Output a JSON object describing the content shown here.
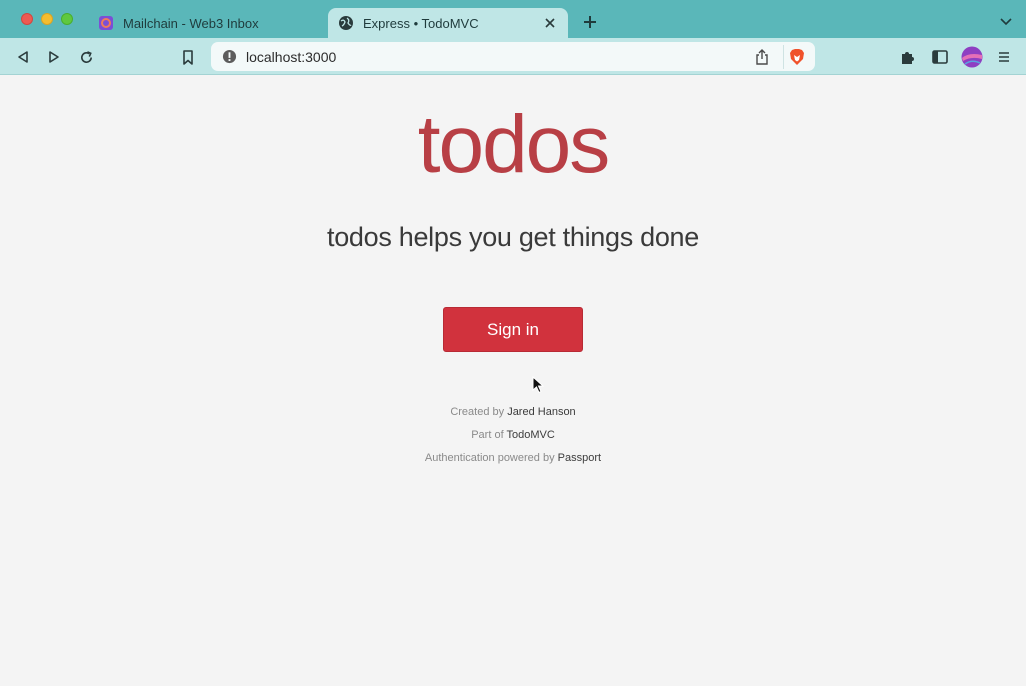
{
  "browser": {
    "tabs": [
      {
        "title": "Mailchain - Web3 Inbox",
        "favicon": "mailchain-icon"
      },
      {
        "title": "Express • TodoMVC",
        "favicon": "globe-icon"
      }
    ],
    "address": "localhost:3000",
    "colors": {
      "tabbar": "#5ab7b9",
      "toolbar": "#bfe6e6"
    }
  },
  "page": {
    "logo": "todos",
    "tagline": "todos helps you get things done",
    "signin_label": "Sign in",
    "footer": {
      "created_prefix": "Created by",
      "created_link": "Jared Hanson",
      "part_prefix": "Part of",
      "part_link": "TodoMVC",
      "auth_prefix": "Authentication powered by",
      "auth_link": "Passport"
    },
    "colors": {
      "accent": "#b83f45",
      "button": "#d1323d"
    }
  }
}
